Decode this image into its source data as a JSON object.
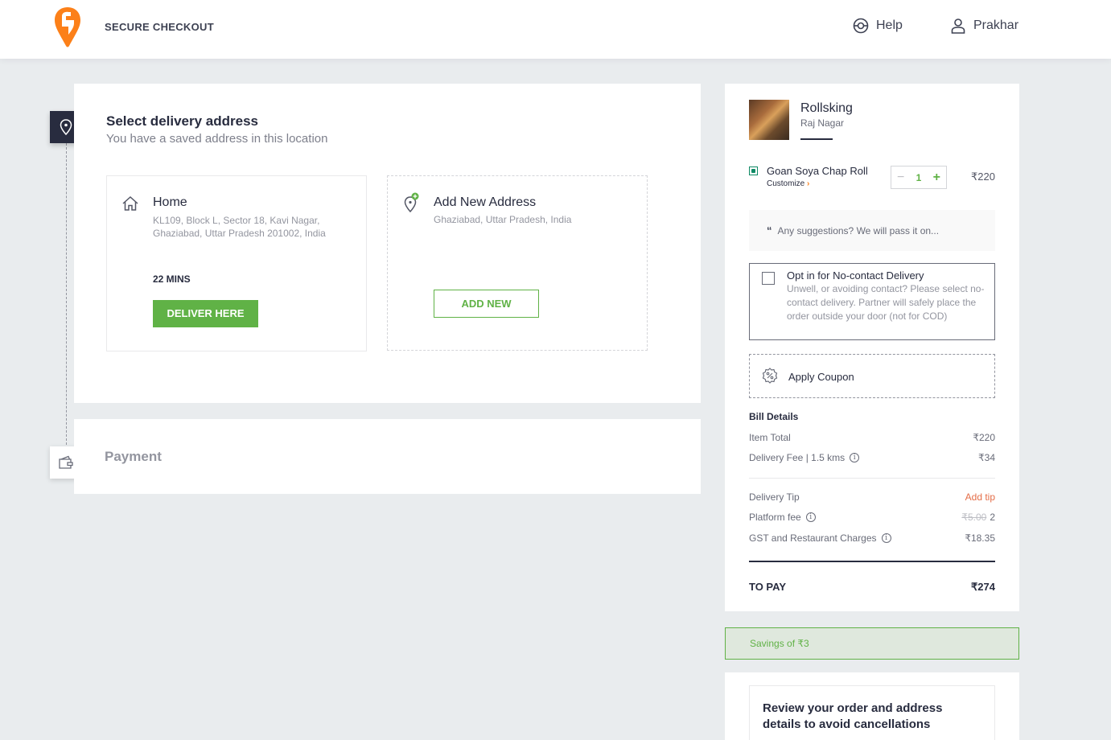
{
  "header": {
    "title": "SECURE CHECKOUT",
    "help_label": "Help",
    "user_name": "Prakhar"
  },
  "address_section": {
    "title": "Select delivery address",
    "subtitle": "You have a saved address in this location",
    "saved": {
      "label": "Home",
      "address": "KL109, Block L, Sector 18, Kavi Nagar, Ghaziabad, Uttar Pradesh 201002, India",
      "eta": "22 MINS",
      "button": "DELIVER HERE"
    },
    "new": {
      "label": "Add New Address",
      "location": "Ghaziabad, Uttar Pradesh, India",
      "button": "ADD NEW"
    }
  },
  "payment_section": {
    "title": "Payment"
  },
  "cart": {
    "restaurant": "Rollsking",
    "area": "Raj Nagar",
    "item": {
      "name": "Goan Soya Chap Roll",
      "customize": "Customize",
      "quantity": "1",
      "price": "₹220"
    },
    "suggestion_placeholder": "Any suggestions? We will pass it on...",
    "no_contact": {
      "title": "Opt in for No-contact Delivery",
      "description": "Unwell, or avoiding contact? Please select no-contact delivery. Partner will safely place the order outside your door (not for COD)"
    },
    "coupon_label": "Apply Coupon",
    "bill": {
      "heading": "Bill Details",
      "item_total_label": "Item Total",
      "item_total": "₹220",
      "delivery_fee_label": "Delivery Fee | 1.5 kms",
      "delivery_fee": "₹34",
      "tip_label": "Delivery Tip",
      "tip_action": "Add tip",
      "platform_fee_label": "Platform fee",
      "platform_fee_old": "₹5.00",
      "platform_fee": "2",
      "gst_label": "GST and Restaurant Charges",
      "gst": "₹18.35",
      "to_pay_label": "TO PAY",
      "to_pay": "₹274"
    },
    "savings": "Savings of ₹3",
    "review_text": "Review your order and address details to avoid cancellations"
  },
  "colors": {
    "brand": "#fc8019",
    "green": "#60b246",
    "dark": "#282c3f",
    "tip": "#e46d47"
  }
}
